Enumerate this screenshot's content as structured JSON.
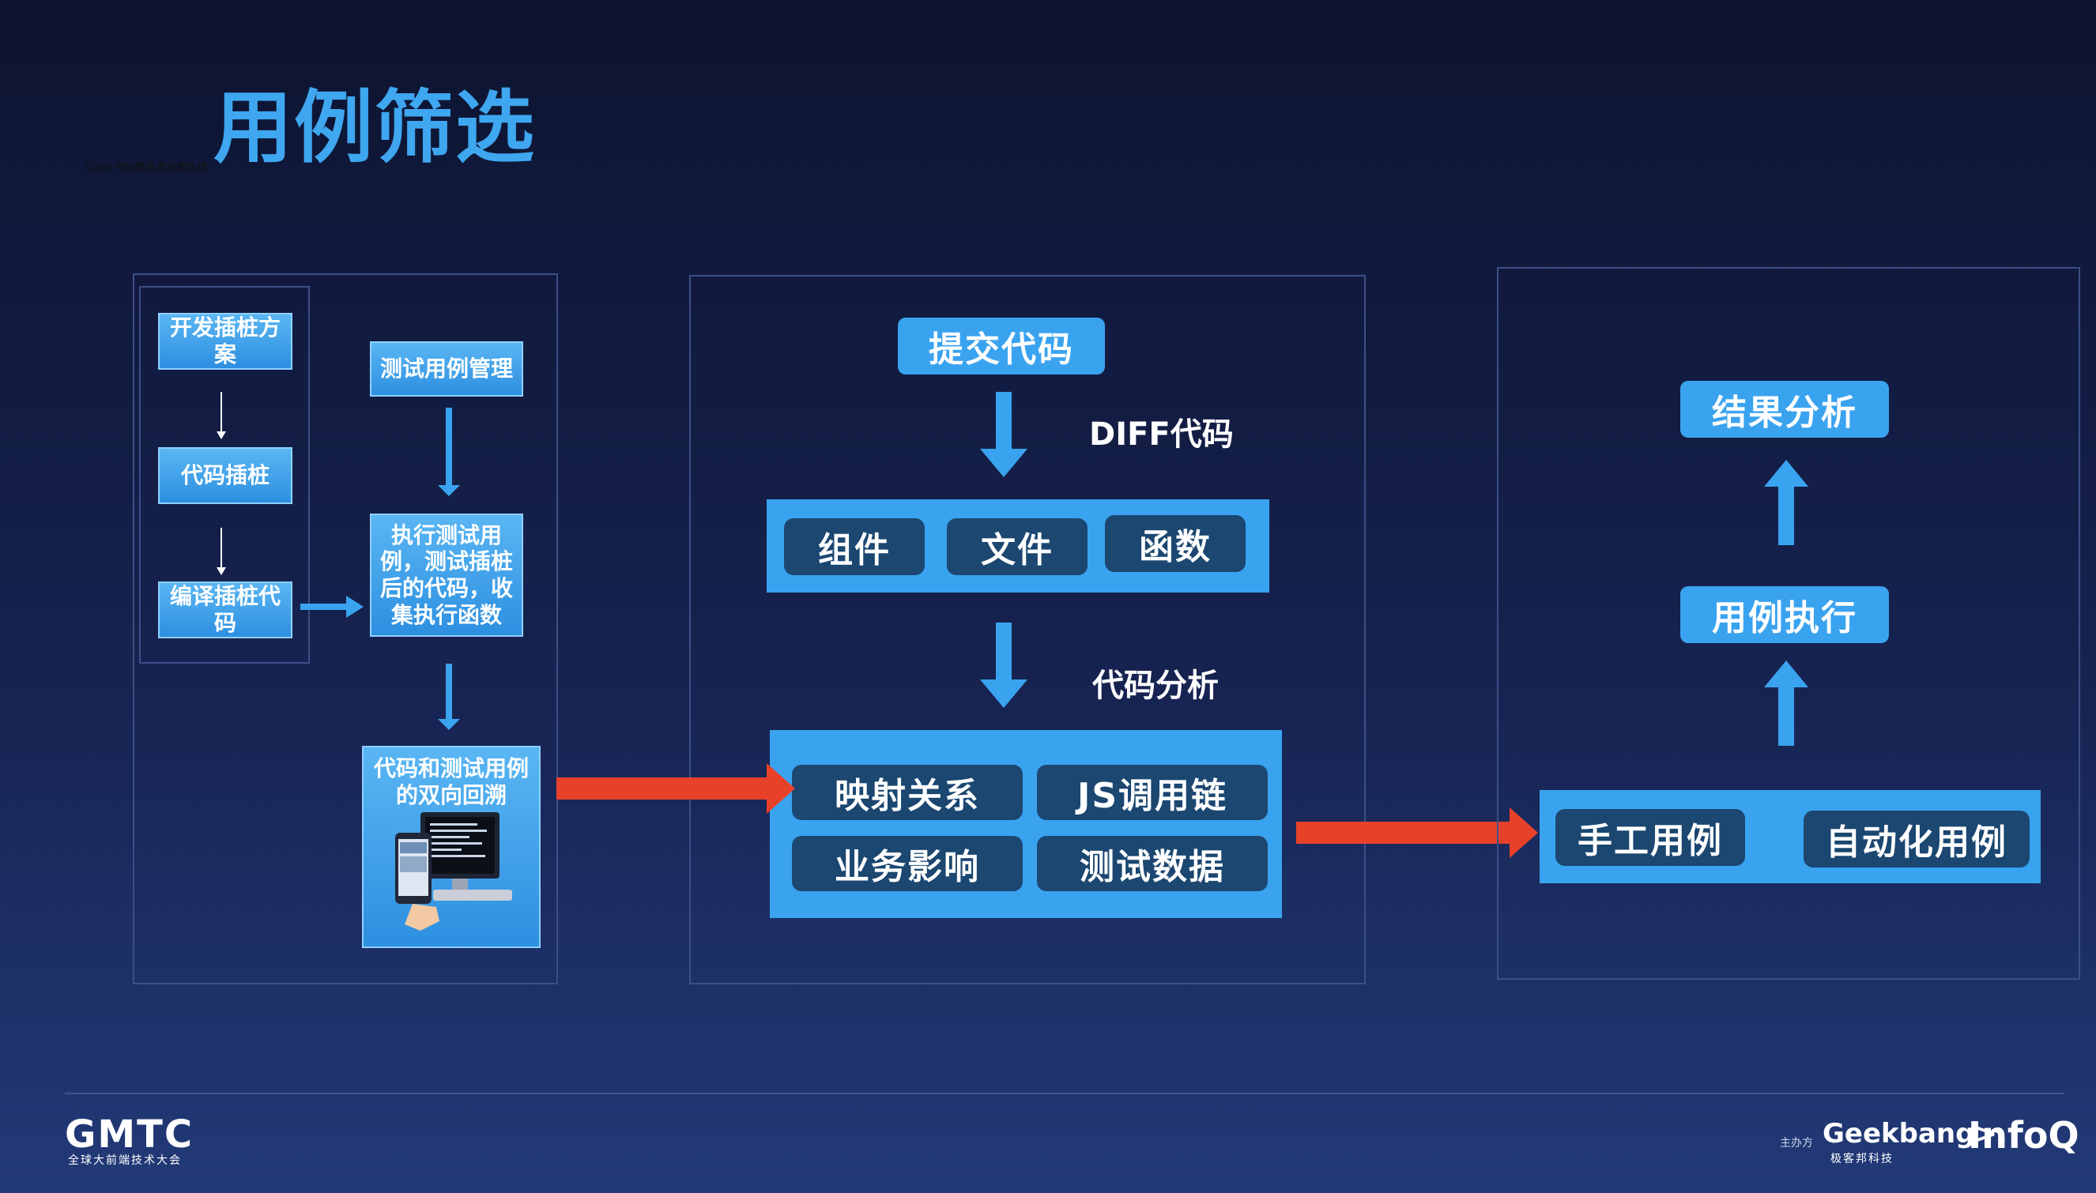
{
  "title": "用例筛选",
  "tiny_label": "Cone 代码覆盖率方案生成",
  "left_panel": {
    "steps": [
      "开发插桩方案",
      "代码插桩",
      "编译插桩代码"
    ],
    "test_case_mgmt": "测试用例管理",
    "execute": "执行测试用例，测试插桩后的代码，收集执行函数",
    "trace": "代码和测试用例的双向回溯"
  },
  "middle_panel": {
    "submit": "提交代码",
    "diff_label": "DIFF代码",
    "diff_items": [
      "组件",
      "文件",
      "函数"
    ],
    "analysis_label": "代码分析",
    "analysis_items": [
      "映射关系",
      "JS调用链",
      "业务影响",
      "测试数据"
    ]
  },
  "right_panel": {
    "result": "结果分析",
    "execute": "用例执行",
    "case_types": [
      "手工用例",
      "自动化用例"
    ]
  },
  "footer": {
    "brand": "GMTC",
    "brand_sub": "全球大前端技术大会",
    "host_label": "主办方",
    "sponsor1": "Geekbang>.",
    "sponsor1_sub": "极客邦科技",
    "sponsor2": "InfoQ"
  },
  "colors": {
    "accent_blue": "#3aa3ef",
    "dark_box": "#1b4771",
    "red_arrow": "#e8412a",
    "title_blue": "#3fa6f0"
  }
}
